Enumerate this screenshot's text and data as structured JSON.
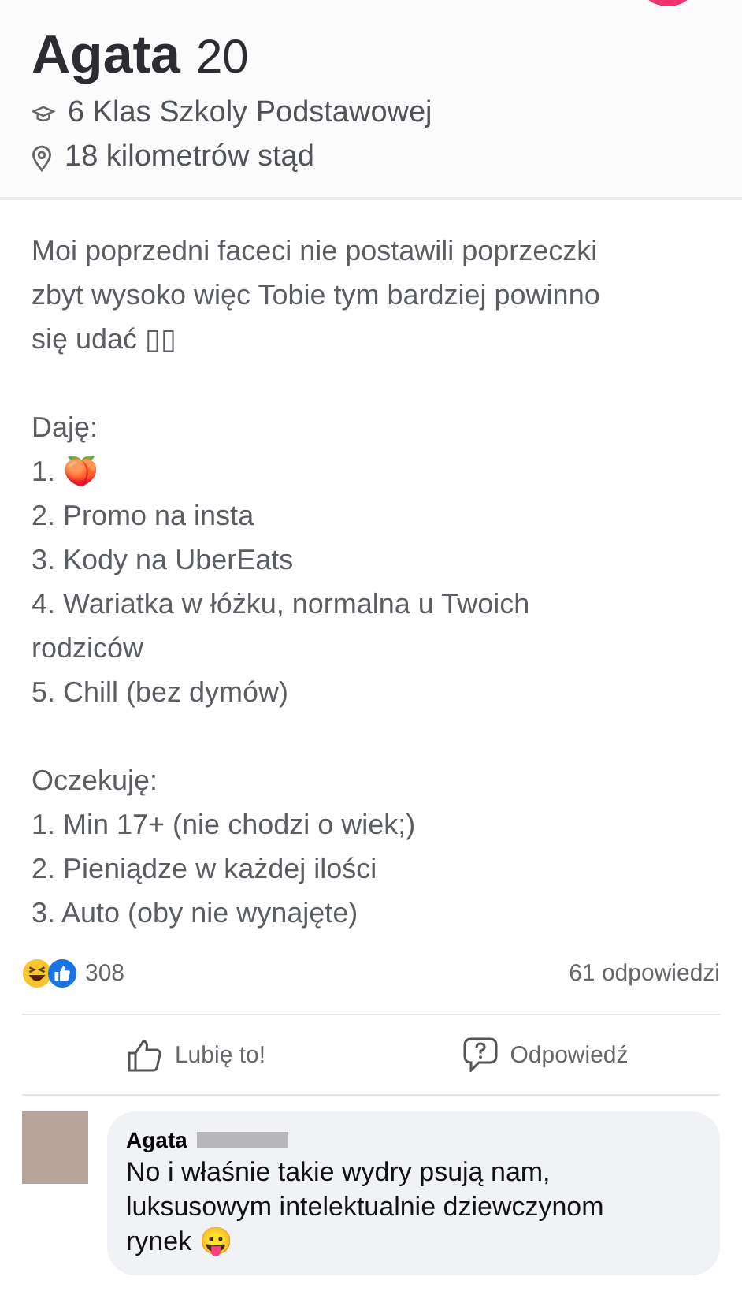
{
  "profile": {
    "name": "Agata",
    "age": "20",
    "school": "6 Klas Szkoly Podstawowej",
    "distance": "18 kilometrów stąd"
  },
  "bio": [
    {
      "kind": "paragraph",
      "text": "Moi poprzedni faceci nie postawili poprzeczki zbyt wysoko więc Tobie tym bardziej powinno się udać ▯▯"
    },
    {
      "kind": "list",
      "heading": "Daję:",
      "items": [
        "1. 🍑",
        "2. Promo na insta",
        "3. Kody na UberEats",
        "4. Wariatka w łóżku, normalna u Twoich rodziców",
        "5. Chill (bez dymów)"
      ]
    },
    {
      "kind": "list",
      "heading": "Oczekuję:",
      "items": [
        "1. Min 17+ (nie chodzi o wiek;)",
        "2. Pieniądze w każdej ilości",
        "3. Auto (oby nie wynajęte)"
      ]
    }
  ],
  "reactions": {
    "count": "308",
    "replies": "61 odpowiedzi"
  },
  "actions": [
    {
      "kind": "like",
      "label": "Lubię to!"
    },
    {
      "kind": "reply",
      "label": "Odpowiedź"
    }
  ],
  "comment": {
    "author": "Agata",
    "text": "No i właśnie takie wydry psują nam, luksusowym intelektualnie dziewczynom rynek 😛"
  }
}
